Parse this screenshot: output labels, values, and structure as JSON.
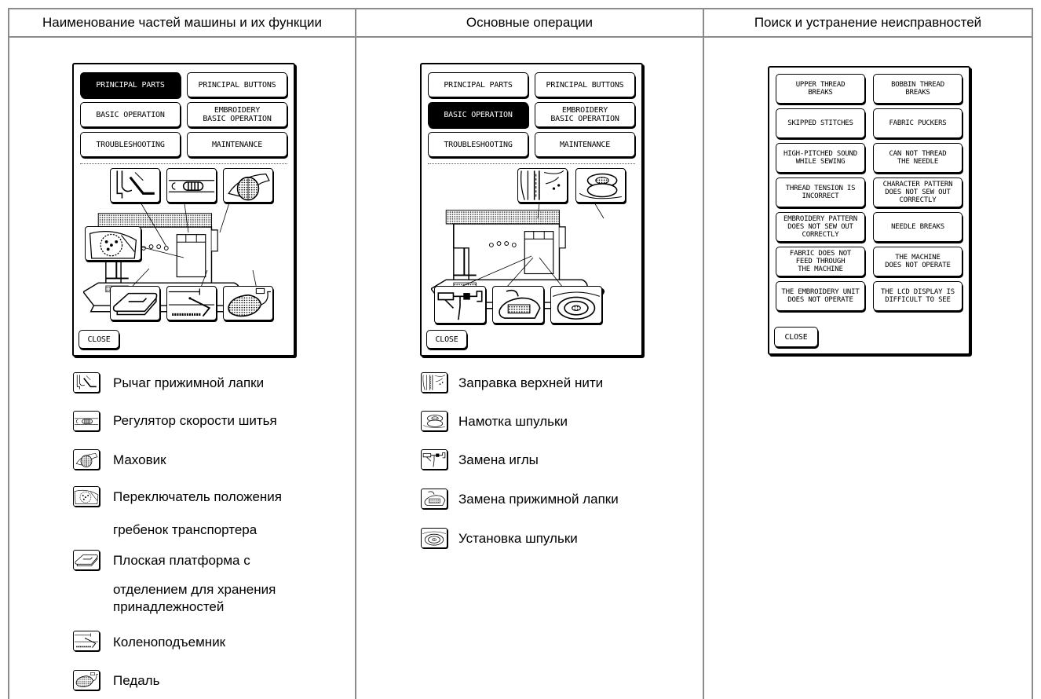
{
  "headers": {
    "col1": "Наименование частей машины и их функции",
    "col2": "Основные операции",
    "col3": "Поиск и устранение неисправностей"
  },
  "menu": {
    "principal_parts": "PRINCIPAL PARTS",
    "principal_buttons": "PRINCIPAL BUTTONS",
    "basic_operation": "BASIC OPERATION",
    "embroidery_basic_operation": "EMBROIDERY\nBASIC OPERATION",
    "troubleshooting": "TROUBLESHOOTING",
    "maintenance": "MAINTENANCE",
    "close": "CLOSE"
  },
  "troubleshooting_items": [
    "UPPER THREAD\nBREAKS",
    "BOBBIN THREAD\nBREAKS",
    "SKIPPED STITCHES",
    "FABRIC PUCKERS",
    "HIGH-PITCHED SOUND\nWHILE SEWING",
    "CAN NOT THREAD\nTHE NEEDLE",
    "THREAD TENSION IS\nINCORRECT",
    "CHARACTER PATTERN\nDOES NOT SEW OUT\nCORRECTLY",
    "EMBROIDERY PATTERN\nDOES NOT SEW OUT\nCORRECTLY",
    "NEEDLE BREAKS",
    "FABRIC DOES NOT\nFEED THROUGH\nTHE MACHINE",
    "THE MACHINE\nDOES NOT OPERATE",
    "THE EMBROIDERY UNIT\nDOES NOT OPERATE",
    "THE LCD DISPLAY IS\nDIFFICULT TO SEE"
  ],
  "legend_parts": [
    {
      "icon": "presser-foot-lever-icon",
      "label": "Рычаг прижимной лапки"
    },
    {
      "icon": "speed-control-slider-icon",
      "label": "Регулятор скорости шитья"
    },
    {
      "icon": "handwheel-icon",
      "label": "Маховик"
    },
    {
      "icon": "feed-dog-switch-icon",
      "label": "Переключатель положения",
      "label2": "гребенок транспортера"
    },
    {
      "icon": "flat-bed-attachment-icon",
      "label": "Плоская платформа с",
      "label2": "отделением для хранения",
      "label3": "принадлежностей"
    },
    {
      "icon": "knee-lifter-icon",
      "label": "Коленоподъемник"
    },
    {
      "icon": "foot-controller-icon",
      "label": "Педаль"
    }
  ],
  "legend_operations": [
    {
      "icon": "upper-threading-icon",
      "label": "Заправка верхней нити"
    },
    {
      "icon": "bobbin-winding-icon",
      "label": "Намотка шпульки"
    },
    {
      "icon": "needle-change-icon",
      "label": "Замена иглы"
    },
    {
      "icon": "presser-foot-change-icon",
      "label": "Замена прижимной лапки"
    },
    {
      "icon": "bobbin-setting-icon",
      "label": "Установка шпульки"
    }
  ]
}
